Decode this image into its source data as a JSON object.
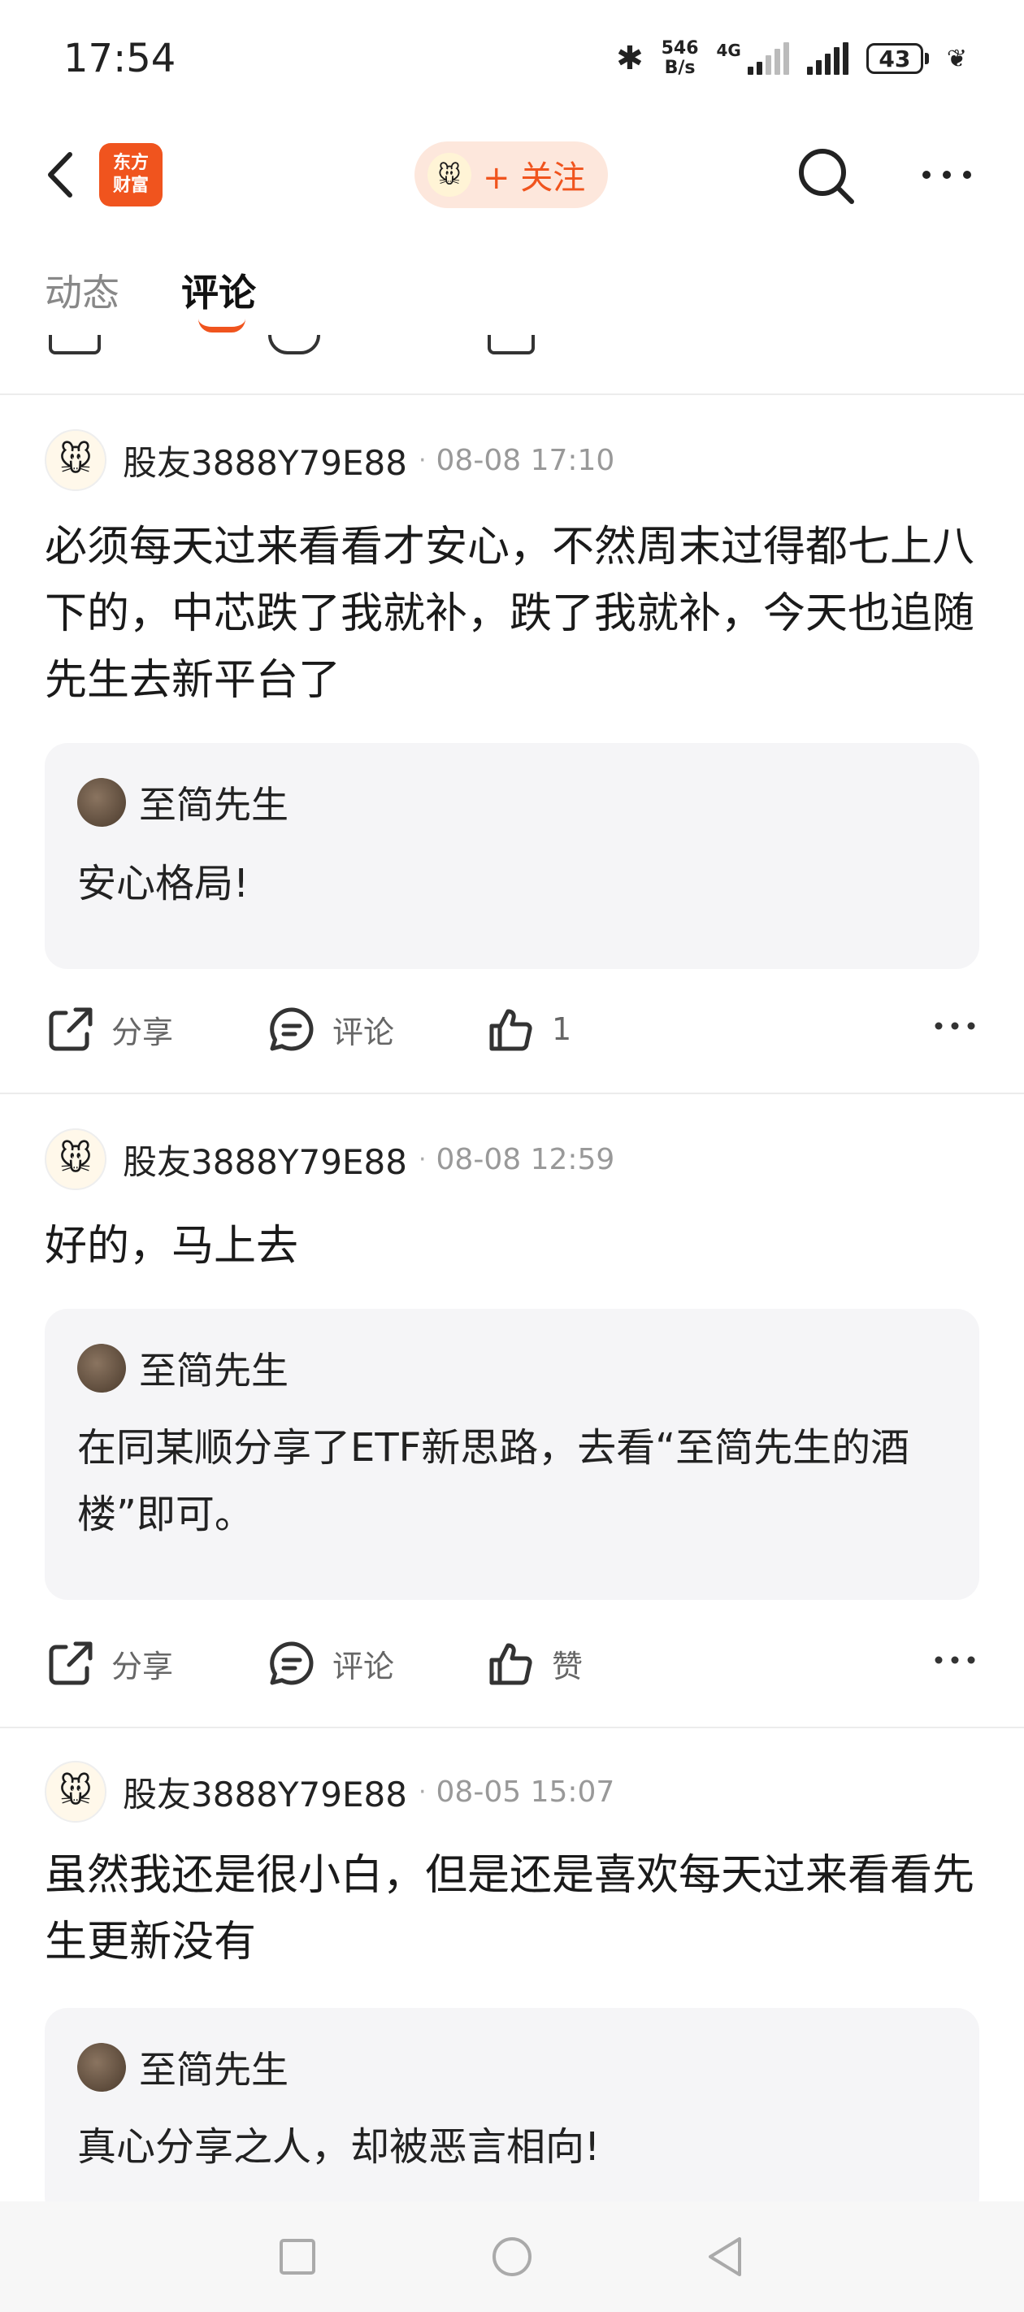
{
  "status_bar": {
    "time": "17:54",
    "net_speed_top": "546",
    "net_speed_bottom": "B/s",
    "network_type": "4G",
    "battery": "43"
  },
  "nav": {
    "logo_line1": "东方",
    "logo_line2": "财富",
    "follow_label": "+ 关注"
  },
  "tabs": {
    "dynamic": "动态",
    "comments": "评论"
  },
  "comments": [
    {
      "username": "股友3888Y79E88",
      "time": "08-08 17:10",
      "text": "必须每天过来看看才安心，不然周末过得都七上八下的，中芯跌了我就补，跌了我就补，今天也追随先生去新平台了",
      "reply_name": "至简先生",
      "reply_text": "安心格局!",
      "share_label": "分享",
      "comment_label": "评论",
      "like_label": "1"
    },
    {
      "username": "股友3888Y79E88",
      "time": "08-08 12:59",
      "text": "好的，马上去",
      "reply_name": "至简先生",
      "reply_text": "在同某顺分享了ETF新思路，去看“至简先生的酒楼”即可。",
      "share_label": "分享",
      "comment_label": "评论",
      "like_label": "赞"
    },
    {
      "username": "股友3888Y79E88",
      "time": "08-05 15:07",
      "text": "虽然我还是很小白，但是还是喜欢每天过来看看先生更新没有",
      "reply_name": "至简先生",
      "reply_text": "真心分享之人，却被恶言相向!"
    }
  ],
  "separator": "·",
  "colors": {
    "accent": "#f0541e",
    "follow_bg": "#fde7dc",
    "quote_bg": "#f5f5f7"
  }
}
